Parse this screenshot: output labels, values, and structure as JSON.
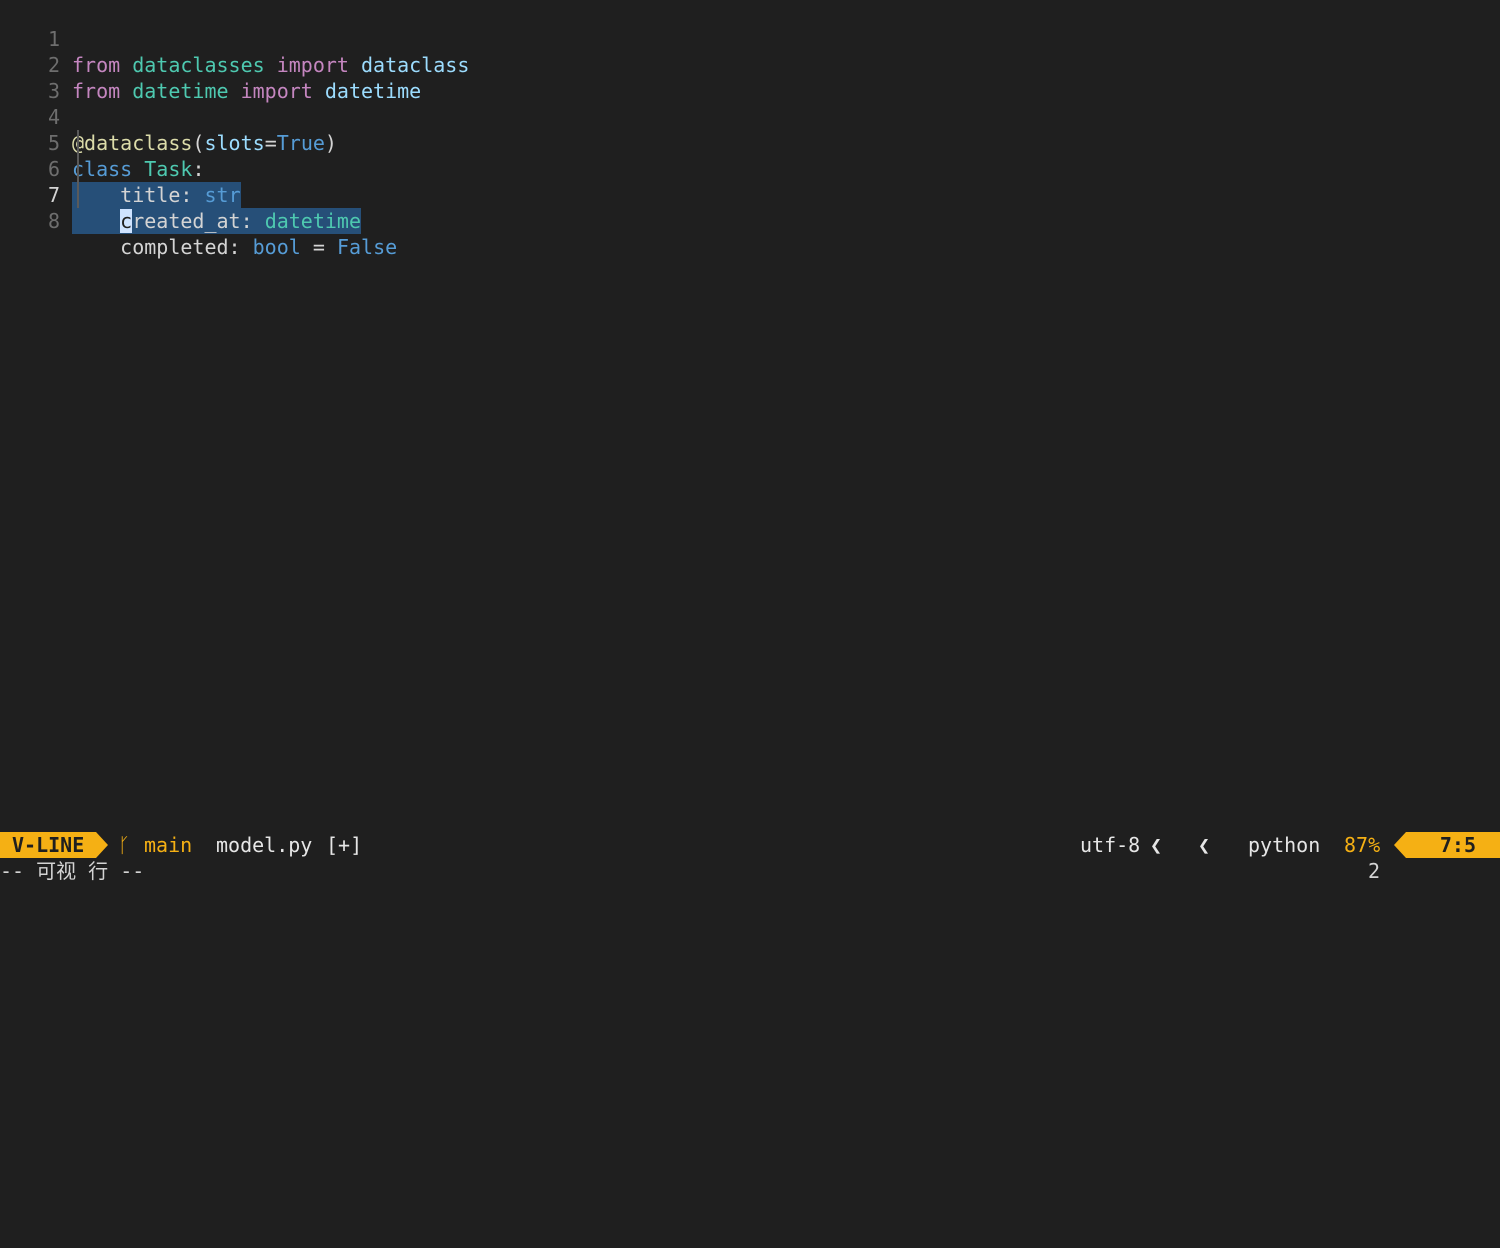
{
  "editor": {
    "lines": [
      {
        "number": "1",
        "tokens": [
          "from",
          "dataclasses",
          "import",
          "dataclass"
        ]
      },
      {
        "number": "2",
        "tokens": [
          "from",
          "datetime",
          "import",
          "datetime"
        ]
      },
      {
        "number": "3",
        "tokens": []
      },
      {
        "number": "4",
        "tokens": [
          "@dataclass",
          "(",
          "slots",
          "=",
          "True",
          ")"
        ]
      },
      {
        "number": "5",
        "tokens": [
          "class",
          "Task",
          ":"
        ]
      },
      {
        "number": "6",
        "tokens": [
          "title",
          ":",
          "str"
        ]
      },
      {
        "number": "7",
        "tokens": [
          "c",
          "reated_at",
          ":",
          "datetime"
        ]
      },
      {
        "number": "8",
        "tokens": [
          "completed",
          ":",
          "bool",
          "=",
          "False"
        ]
      }
    ],
    "current_line": "7",
    "selected_lines": [
      "6",
      "7"
    ]
  },
  "statusline": {
    "mode": "V-LINE",
    "branch_icon": "git-branch-icon",
    "branch": "main",
    "filename": "model.py",
    "modified": "[+]",
    "encoding": "utf-8",
    "separator": "❮",
    "os_icon": "linux-icon",
    "filetype_icon": "python-icon",
    "filetype": "python",
    "percent": "87%",
    "position": "7:5"
  },
  "cmdline": {
    "mode_text": "-- 可视 行 --",
    "selection_count": "2"
  },
  "colors": {
    "background": "#1f1f1f",
    "accent": "#f5b014",
    "selection": "#264f78"
  }
}
